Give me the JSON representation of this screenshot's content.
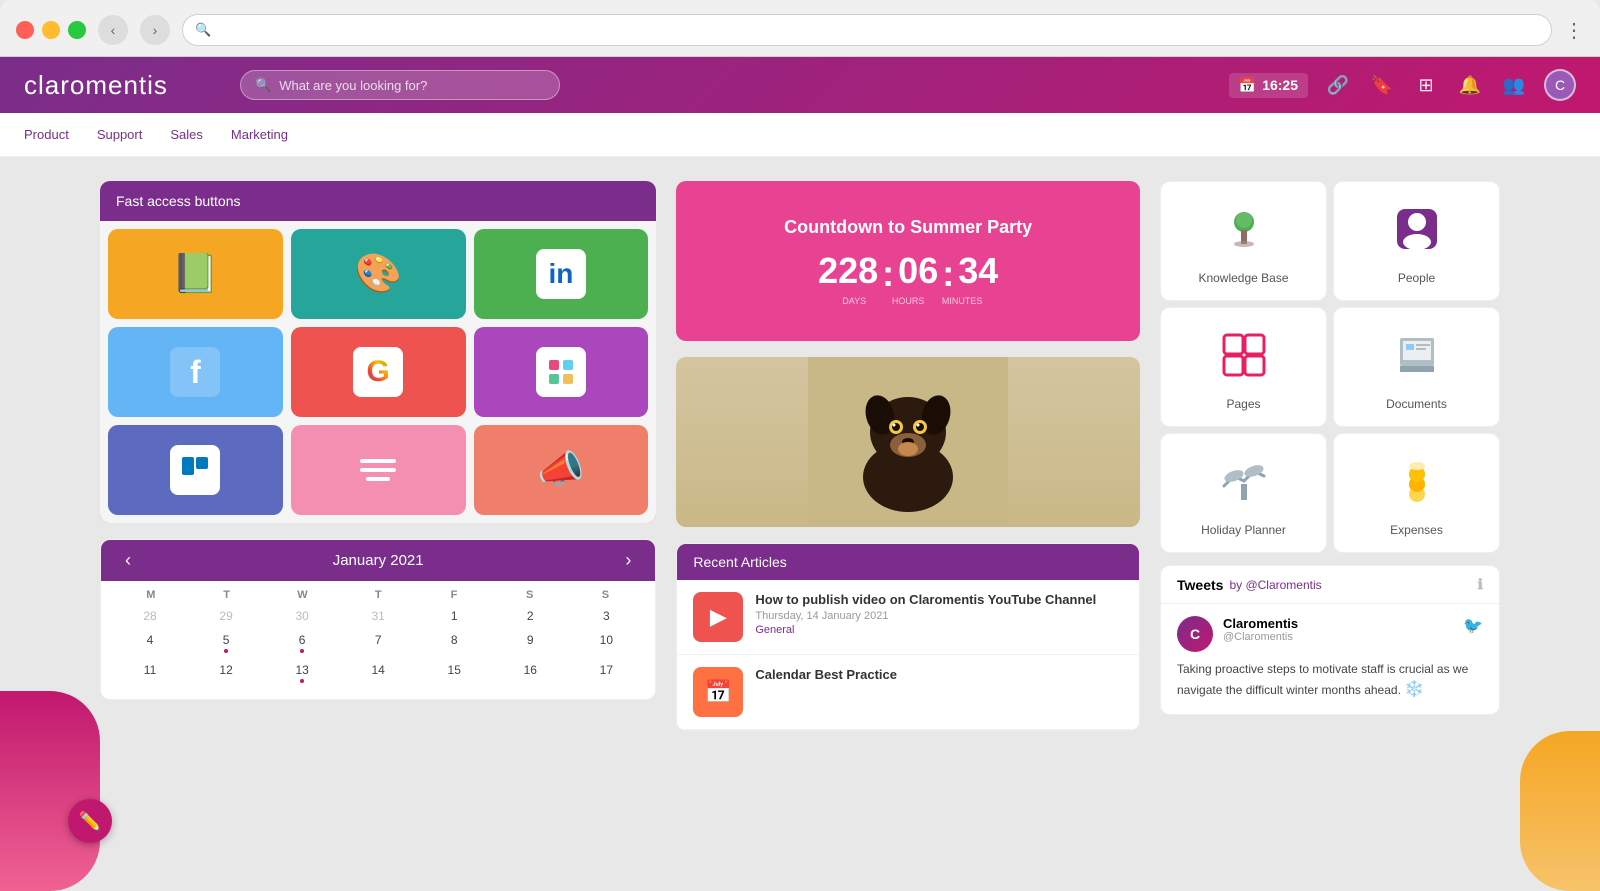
{
  "browser": {
    "back_btn": "‹",
    "forward_btn": "›",
    "address_placeholder": "",
    "search_icon": "🔍",
    "more_icon": "⋮"
  },
  "header": {
    "logo": "claromentis",
    "search_placeholder": "What are you looking for?",
    "time": "16:25",
    "calendar_icon": "📅",
    "link_icon": "🔗",
    "bookmark_icon": "🔖",
    "grid_icon": "⊞",
    "bell_icon": "🔔",
    "people_icon": "👥",
    "avatar_initials": "C"
  },
  "nav": {
    "items": [
      {
        "label": "Product"
      },
      {
        "label": "Support"
      },
      {
        "label": "Sales"
      },
      {
        "label": "Marketing"
      }
    ]
  },
  "fast_access": {
    "title": "Fast access buttons",
    "buttons": [
      {
        "icon": "📗",
        "color": "btn-orange",
        "name": "book-app"
      },
      {
        "icon": "🎨",
        "color": "btn-teal",
        "name": "design-app"
      },
      {
        "icon": "in",
        "color": "btn-green",
        "name": "linkedin-app",
        "text_icon": true
      },
      {
        "icon": "f",
        "color": "btn-blue",
        "name": "facebook-app",
        "text_icon": true
      },
      {
        "icon": "G",
        "color": "btn-red",
        "name": "google-app",
        "text_icon": true
      },
      {
        "icon": "⧉",
        "color": "btn-purple",
        "name": "slack-app"
      },
      {
        "icon": "▦",
        "color": "btn-indigo",
        "name": "trello-app"
      },
      {
        "icon": "≡",
        "color": "btn-pink",
        "name": "list-app"
      },
      {
        "icon": "📣",
        "color": "btn-salmon",
        "name": "announce-app"
      }
    ]
  },
  "calendar": {
    "title": "January 2021",
    "prev_label": "‹",
    "next_label": "›",
    "day_headers": [
      "M",
      "T",
      "W",
      "T",
      "F",
      "S",
      "S"
    ],
    "weeks": [
      [
        {
          "day": "28",
          "other": true,
          "dot": false
        },
        {
          "day": "29",
          "other": true,
          "dot": false
        },
        {
          "day": "30",
          "other": true,
          "dot": false
        },
        {
          "day": "31",
          "other": true,
          "dot": false
        },
        {
          "day": "1",
          "other": false,
          "dot": false
        },
        {
          "day": "2",
          "other": false,
          "dot": false
        },
        {
          "day": "3",
          "other": false,
          "dot": false
        }
      ],
      [
        {
          "day": "4",
          "other": false,
          "dot": false
        },
        {
          "day": "5",
          "other": false,
          "dot": false
        },
        {
          "day": "6",
          "other": false,
          "dot": true
        },
        {
          "day": "7",
          "other": false,
          "dot": false
        },
        {
          "day": "8",
          "other": false,
          "dot": false
        },
        {
          "day": "9",
          "other": false,
          "dot": false
        },
        {
          "day": "10",
          "other": false,
          "dot": false
        }
      ],
      [
        {
          "day": "11",
          "other": false,
          "dot": false
        },
        {
          "day": "12",
          "other": false,
          "dot": false
        },
        {
          "day": "13",
          "other": false,
          "dot": false
        },
        {
          "day": "14",
          "other": false,
          "dot": false,
          "today": true
        },
        {
          "day": "15",
          "other": false,
          "dot": false
        },
        {
          "day": "16",
          "other": false,
          "dot": false
        },
        {
          "day": "17",
          "other": false,
          "dot": false
        }
      ]
    ]
  },
  "countdown": {
    "title": "Countdown to Summer Party",
    "days": "228",
    "hours": "06",
    "minutes": "34",
    "days_label": "DAYS",
    "hours_label": "HOURS",
    "minutes_label": "MINUTES"
  },
  "app_icons": [
    {
      "id": "knowledge-base",
      "label": "Knowledge Base",
      "icon": "🌳",
      "color": "#4caf50"
    },
    {
      "id": "people",
      "label": "People",
      "icon": "👤",
      "color": "#7b2d8b"
    },
    {
      "id": "pages",
      "label": "Pages",
      "icon": "📋",
      "color": "#e91e63"
    },
    {
      "id": "documents",
      "label": "Documents",
      "icon": "🖼️",
      "color": "#64b5f6"
    },
    {
      "id": "holiday-planner",
      "label": "Holiday Planner",
      "icon": "✈️",
      "color": "#90a4ae"
    },
    {
      "id": "expenses",
      "label": "Expenses",
      "icon": "💰",
      "color": "#ffc107"
    }
  ],
  "recent_articles": {
    "title": "Recent Articles",
    "items": [
      {
        "id": "article-1",
        "thumb_icon": "▶",
        "thumb_color": "article-thumb-red",
        "title": "How to publish video on Claromentis YouTube Channel",
        "date": "Thursday, 14 January 2021",
        "category": "General"
      },
      {
        "id": "article-2",
        "thumb_icon": "📅",
        "thumb_color": "article-thumb-orange",
        "title": "Calendar Best Practice",
        "date": "",
        "category": ""
      }
    ]
  },
  "tweets": {
    "title": "Tweets",
    "by_label": "by @Claromentis",
    "items": [
      {
        "id": "tweet-1",
        "author": "Claromentis",
        "handle": "@Claromentis",
        "text": "Taking proactive steps to motivate staff is crucial as we navigate the difficult winter months ahead.",
        "emoji": "❄️"
      }
    ]
  }
}
